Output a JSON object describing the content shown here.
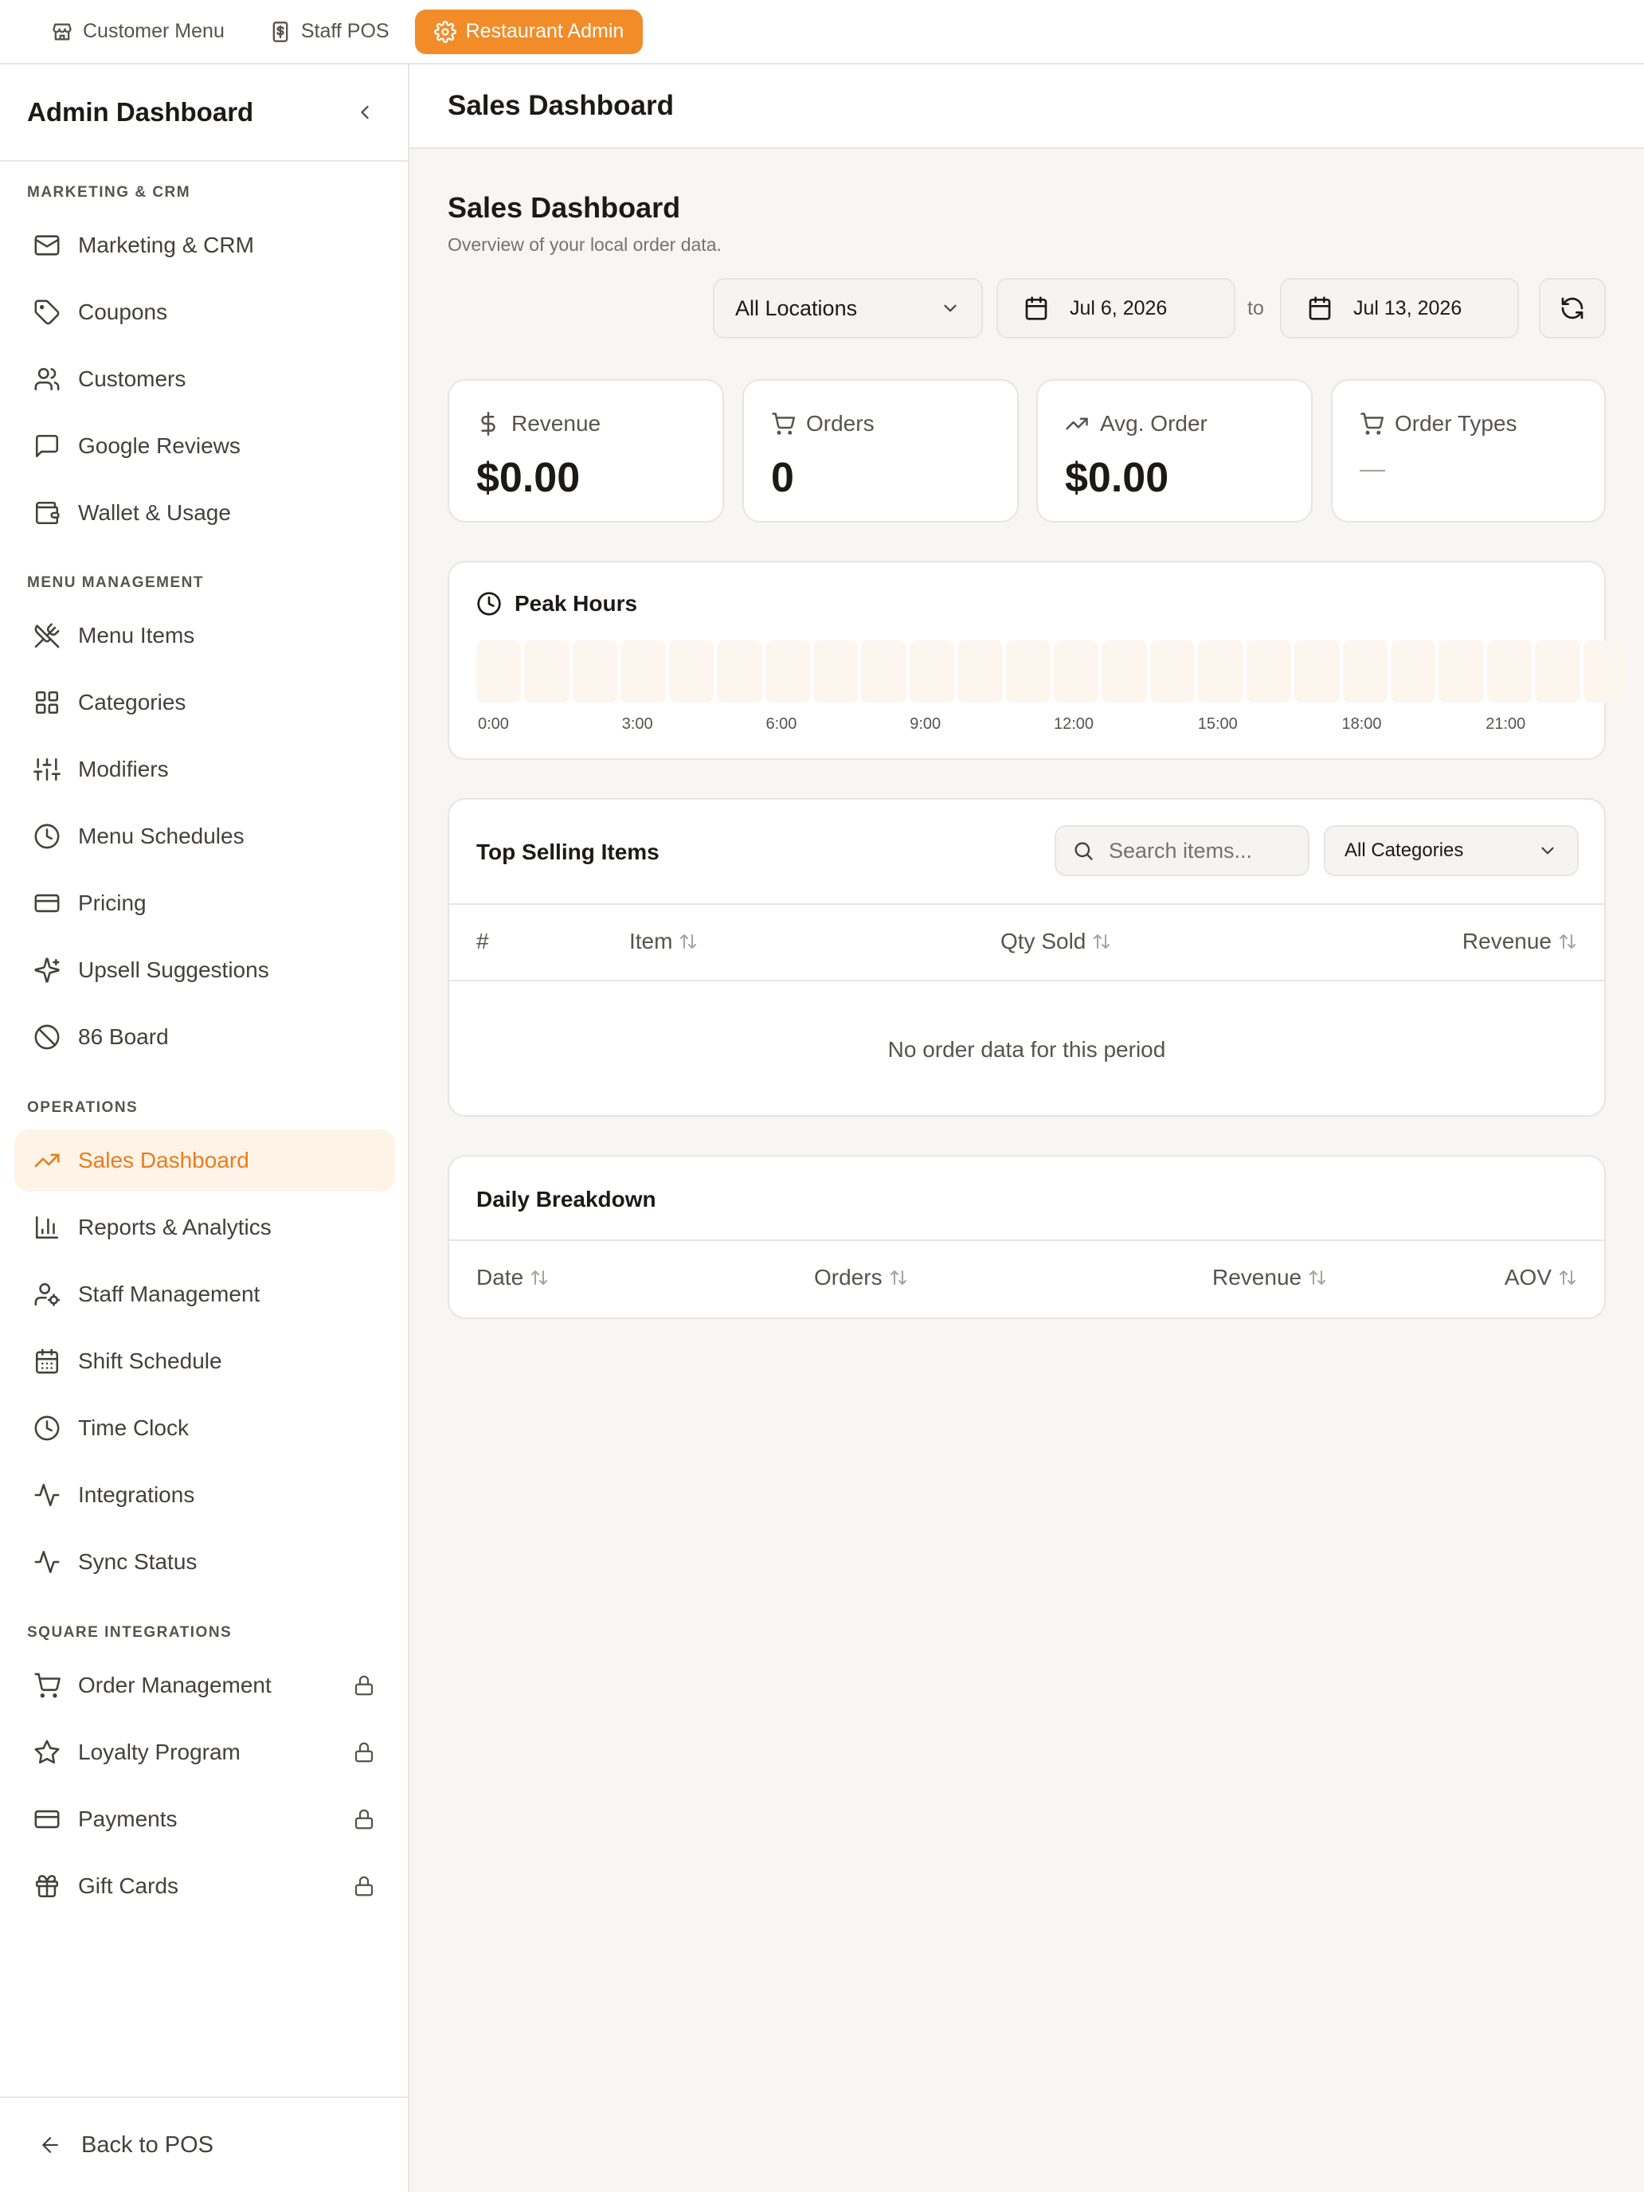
{
  "topbar": {
    "tabs": [
      {
        "label": "Customer Menu",
        "icon": "store-icon"
      },
      {
        "label": "Staff POS",
        "icon": "receipt-icon"
      },
      {
        "label": "Restaurant Admin",
        "icon": "gear-icon",
        "active": true
      }
    ]
  },
  "sidebar": {
    "title": "Admin Dashboard",
    "sections": {
      "marketing": "MARKETING & CRM",
      "menu": "MENU MANAGEMENT",
      "operations": "OPERATIONS",
      "square": "SQUARE INTEGRATIONS"
    },
    "items": [
      {
        "label": "Marketing & CRM",
        "icon": "mail-icon"
      },
      {
        "label": "Coupons",
        "icon": "tag-icon"
      },
      {
        "label": "Customers",
        "icon": "users-icon"
      },
      {
        "label": "Google Reviews",
        "icon": "message-square-icon"
      },
      {
        "label": "Wallet & Usage",
        "icon": "wallet-icon"
      },
      {
        "label": "Menu Items",
        "icon": "utensils-crossed-icon"
      },
      {
        "label": "Categories",
        "icon": "grid-icon"
      },
      {
        "label": "Modifiers",
        "icon": "sliders-icon"
      },
      {
        "label": "Menu Schedules",
        "icon": "clock-icon"
      },
      {
        "label": "Pricing",
        "icon": "credit-card-icon"
      },
      {
        "label": "Upsell Suggestions",
        "icon": "sparkles-icon"
      },
      {
        "label": "86 Board",
        "icon": "ban-icon"
      },
      {
        "label": "Sales Dashboard",
        "icon": "trending-up-icon",
        "active": true
      },
      {
        "label": "Reports & Analytics",
        "icon": "bar-chart-icon"
      },
      {
        "label": "Staff Management",
        "icon": "user-cog-icon"
      },
      {
        "label": "Shift Schedule",
        "icon": "calendar-icon"
      },
      {
        "label": "Time Clock",
        "icon": "clock-icon"
      },
      {
        "label": "Integrations",
        "icon": "activity-icon"
      },
      {
        "label": "Sync Status",
        "icon": "activity-icon"
      },
      {
        "label": "Order Management",
        "icon": "cart-icon",
        "locked": true
      },
      {
        "label": "Loyalty Program",
        "icon": "star-icon",
        "locked": true
      },
      {
        "label": "Payments",
        "icon": "credit-card-icon",
        "locked": true
      },
      {
        "label": "Gift Cards",
        "icon": "gift-icon",
        "locked": true
      }
    ],
    "footer": "Back to POS"
  },
  "main": {
    "header_title": "Sales Dashboard",
    "title": "Sales Dashboard",
    "subtitle": "Overview of your local order data.",
    "filters": {
      "location": "All Locations",
      "start_date": "Jul 6, 2026",
      "to_label": "to",
      "end_date": "Jul 13, 2026"
    },
    "stats": [
      {
        "label": "Revenue",
        "value": "$0.00",
        "icon": "dollar-icon"
      },
      {
        "label": "Orders",
        "value": "0",
        "icon": "cart-icon"
      },
      {
        "label": "Avg. Order",
        "value": "$0.00",
        "icon": "trending-up-icon"
      },
      {
        "label": "Order Types",
        "value": "—",
        "icon": "cart-icon"
      }
    ],
    "peak_hours": {
      "title": "Peak Hours",
      "hour_count": 24,
      "labels": [
        "0:00",
        "3:00",
        "6:00",
        "9:00",
        "12:00",
        "15:00",
        "18:00",
        "21:00"
      ]
    },
    "top_selling": {
      "title": "Top Selling Items",
      "search_placeholder": "Search items...",
      "category_filter": "All Categories",
      "columns": [
        "#",
        "Item",
        "Qty Sold",
        "Revenue"
      ],
      "empty": "No order data for this period"
    },
    "daily": {
      "title": "Daily Breakdown",
      "columns": [
        "Date",
        "Orders",
        "Revenue",
        "AOV"
      ]
    }
  },
  "colors": {
    "accent": "#f28c28",
    "accent_text": "#ea7d1c",
    "accent_bg": "#fef3e7"
  }
}
